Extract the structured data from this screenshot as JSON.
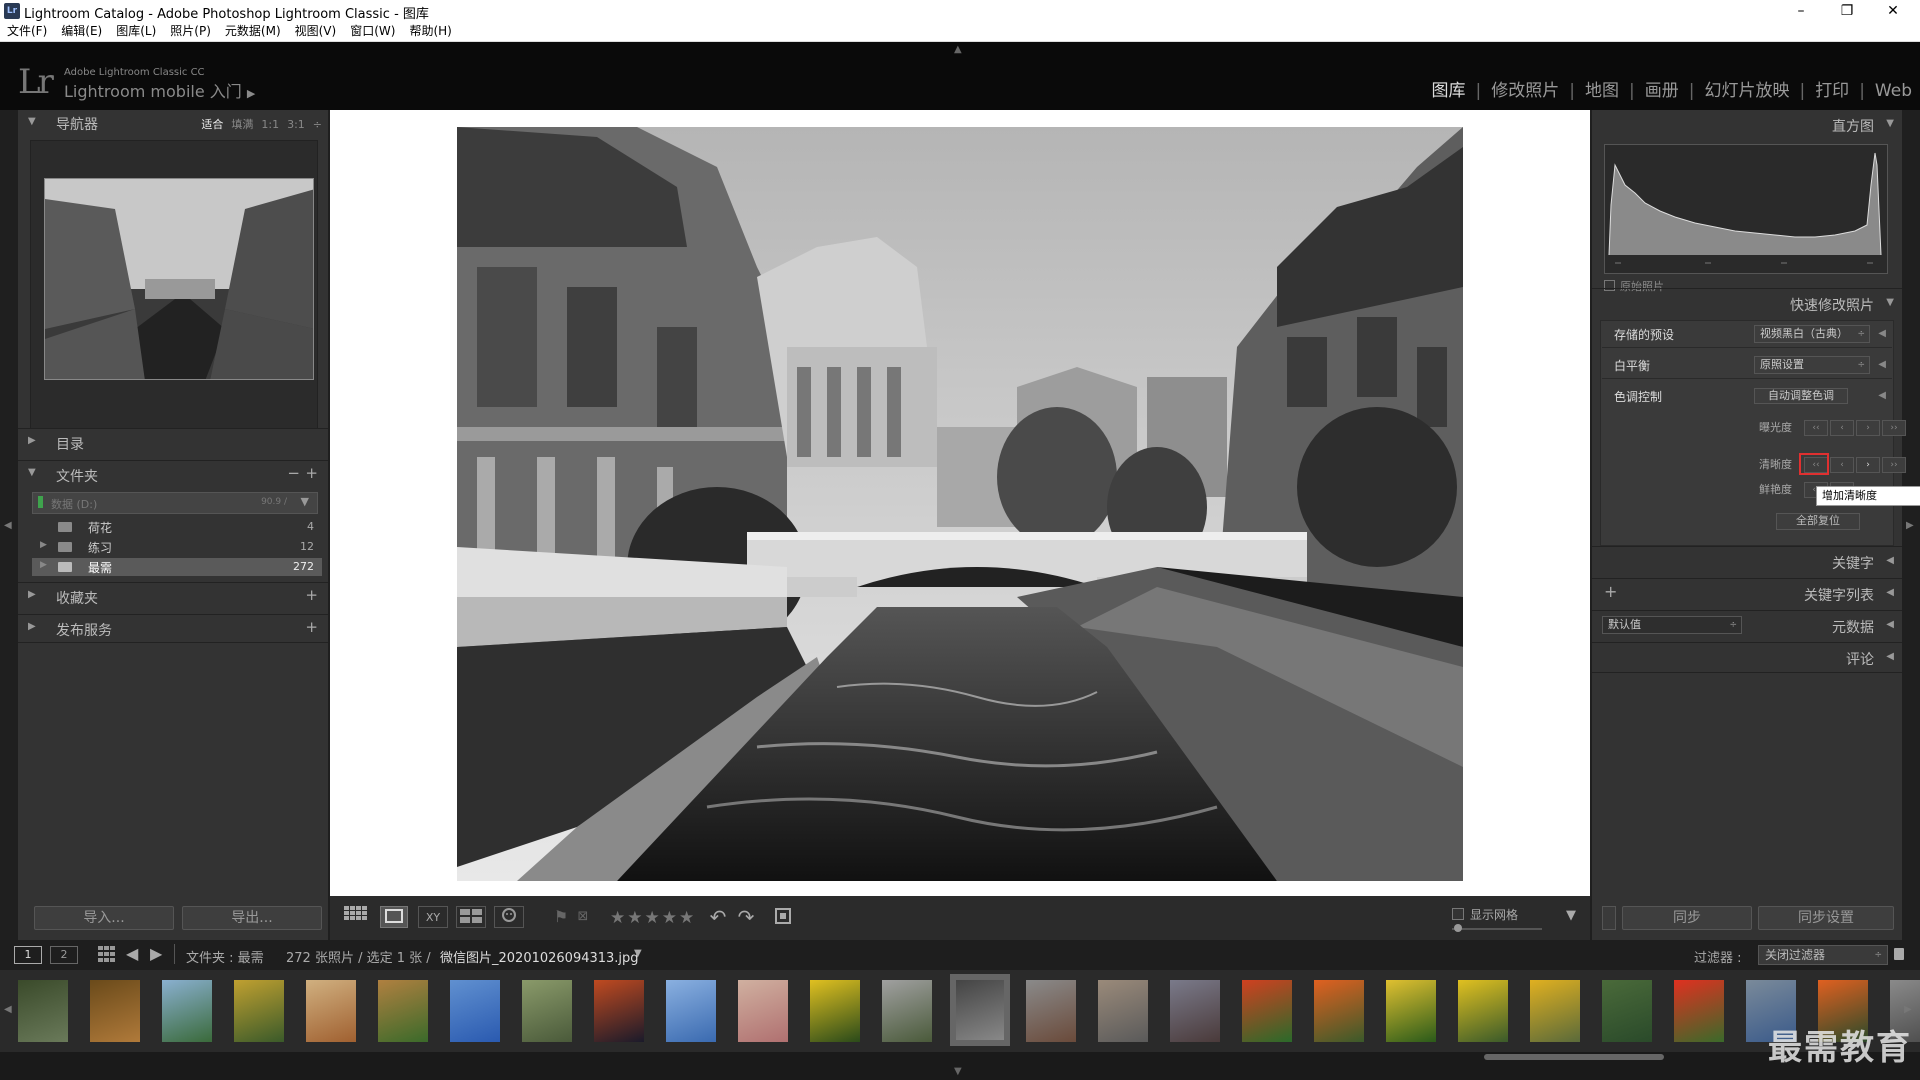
{
  "titlebar": {
    "title": "Lightroom Catalog - Adobe Photoshop Lightroom Classic - 图库",
    "app_badge": "Lr",
    "minimize": "–",
    "maximize": "❐",
    "close": "✕"
  },
  "menu": [
    "文件(F)",
    "编辑(E)",
    "图库(L)",
    "照片(P)",
    "元数据(M)",
    "视图(V)",
    "窗口(W)",
    "帮助(H)"
  ],
  "identity": {
    "logo": "Lr",
    "small": "Adobe Lightroom Classic CC",
    "big": "Lightroom mobile 入门",
    "arrow": "▶"
  },
  "modules": [
    {
      "label": "图库",
      "active": true
    },
    {
      "label": "修改照片",
      "active": false
    },
    {
      "label": "地图",
      "active": false
    },
    {
      "label": "画册",
      "active": false
    },
    {
      "label": "幻灯片放映",
      "active": false
    },
    {
      "label": "打印",
      "active": false
    },
    {
      "label": "Web",
      "active": false
    }
  ],
  "module_sep": "|",
  "left": {
    "navigator": {
      "title": "导航器",
      "opts": [
        "适合",
        "填满",
        "1:1",
        "3:1"
      ],
      "opts_arrow": "÷"
    },
    "catalog": {
      "title": "目录"
    },
    "folders": {
      "title": "文件夹",
      "minus": "−",
      "plus": "+",
      "volume_label": "数据 (D:)",
      "volume_size": "90.9 /"
    },
    "folder_items": [
      {
        "name": "荷花",
        "count": "4"
      },
      {
        "name": "练习",
        "count": "12"
      },
      {
        "name": "最需",
        "count": "272"
      }
    ],
    "collections": {
      "title": "收藏夹",
      "plus": "+"
    },
    "publish": {
      "title": "发布服务",
      "plus": "+"
    },
    "import_btn": "导入...",
    "export_btn": "导出..."
  },
  "toolbar": {
    "stars": "★★★★★",
    "grid_label": "显示网格",
    "icons": [
      "grid-view-icon",
      "loupe-view-icon",
      "compare-view-icon",
      "survey-view-icon",
      "people-view-icon",
      "flag-icon",
      "reject-flag-icon",
      "rotate-left-icon",
      "rotate-right-icon",
      "crop-icon"
    ],
    "compare_glyph": "XY"
  },
  "filmbar": {
    "btn1": "1",
    "btn2": "2",
    "path": "文件夹 : 最需",
    "count": "272 张照片 / 选定 1 张 /",
    "filename": "微信图片_20201026094313.jpg",
    "filter_label": "过滤器 :",
    "filter_value": "关闭过滤器"
  },
  "right": {
    "histogram": {
      "title": "直方图",
      "original": "原始照片"
    },
    "quick_develop": {
      "title": "快速修改照片"
    },
    "saved_preset": {
      "label": "存储的预设",
      "value": "视频黑白（古典）"
    },
    "white_balance": {
      "label": "白平衡",
      "value": "原照设置"
    },
    "tone_control": {
      "label": "色调控制",
      "auto_btn": "自动调整色调"
    },
    "exposure": "曝光度",
    "clarity": "清晰度",
    "vibrance": "鲜艳度",
    "btn_glyphs": [
      "‹‹",
      "‹",
      "›",
      "››"
    ],
    "tooltip": "增加清晰度",
    "reset_all": "全部复位",
    "keywording": "关键字",
    "keyword_list": "关键字列表",
    "keyword_plus": "+",
    "metadata": {
      "title": "元数据",
      "preset": "默认值"
    },
    "comments": "评论",
    "sync_btn": "同步",
    "sync_settings_btn": "同步设置"
  },
  "watermark": "最需教育"
}
